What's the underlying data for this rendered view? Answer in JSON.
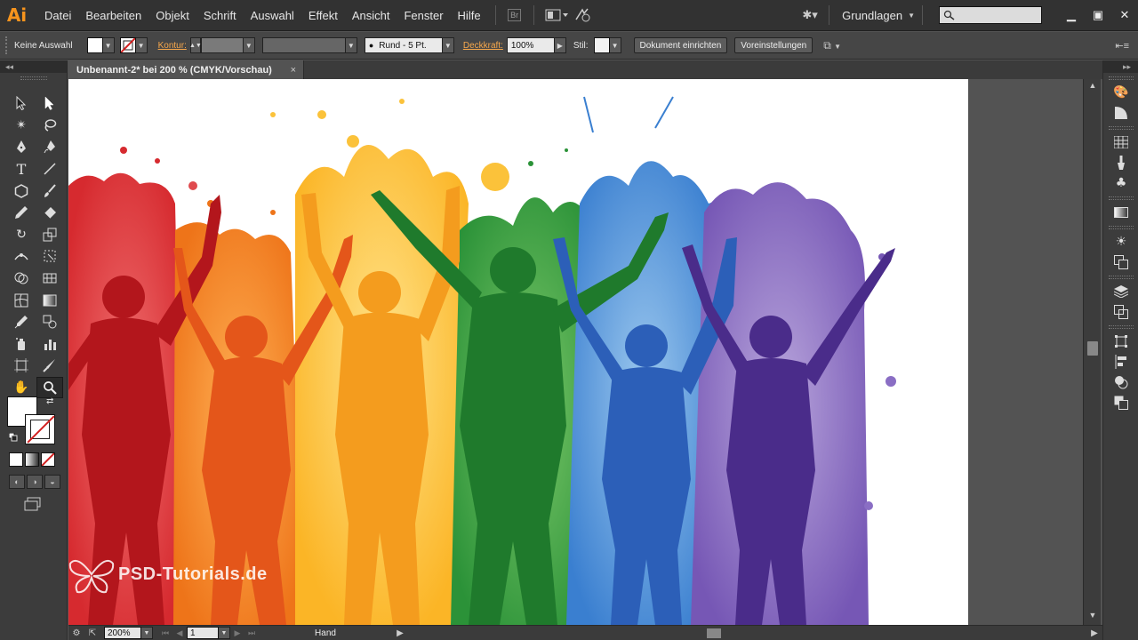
{
  "app": {
    "logo": "Ai"
  },
  "menu": [
    "Datei",
    "Bearbeiten",
    "Objekt",
    "Schrift",
    "Auswahl",
    "Effekt",
    "Ansicht",
    "Fenster",
    "Hilfe"
  ],
  "menubar_icons": {
    "bridge": "Br",
    "arrange": "arrange-documents-icon",
    "gpu": "gpu-performance-icon"
  },
  "workspace": {
    "label": "Grundlagen",
    "search_placeholder": ""
  },
  "control_bar": {
    "selection_label": "Keine Auswahl",
    "stroke_link": "Kontur:",
    "stroke_profile": "Rund - 5 Pt.",
    "opacity_link": "Deckkraft:",
    "opacity_value": "100%",
    "style_label": "Stil:",
    "doc_setup_button": "Dokument einrichten",
    "prefs_button": "Voreinstellungen"
  },
  "document": {
    "tab_title": "Unbenannt-2* bei 200 % (CMYK/Vorschau)",
    "close_glyph": "×"
  },
  "watermark": {
    "text": "PSD-Tutorials.de"
  },
  "status_bar": {
    "zoom": "200%",
    "artboard_number": "1",
    "tool_status": "Hand"
  },
  "colors": {
    "red": "#d62a2f",
    "orange": "#f07a1a",
    "yellow": "#fbbf2a",
    "green": "#2e9a3a",
    "blue": "#3a7fd0",
    "purple": "#6a4aa8",
    "ai_orange": "#f7941d"
  },
  "tools": [
    "selection-tool",
    "direct-selection-tool",
    "magic-wand-tool",
    "lasso-tool",
    "pen-tool",
    "curvature-pen-tool",
    "type-tool",
    "line-tool",
    "ellipse-tool",
    "paintbrush-tool",
    "pencil-tool",
    "eraser-tool",
    "rotate-tool",
    "scale-tool",
    "width-tool",
    "free-transform-tool",
    "shape-builder-tool",
    "perspective-grid-tool",
    "mesh-tool",
    "gradient-tool",
    "eyedropper-tool",
    "blend-tool",
    "symbol-sprayer-tool",
    "graph-tool",
    "artboard-tool",
    "slice-tool",
    "hand-tool",
    "zoom-tool"
  ]
}
